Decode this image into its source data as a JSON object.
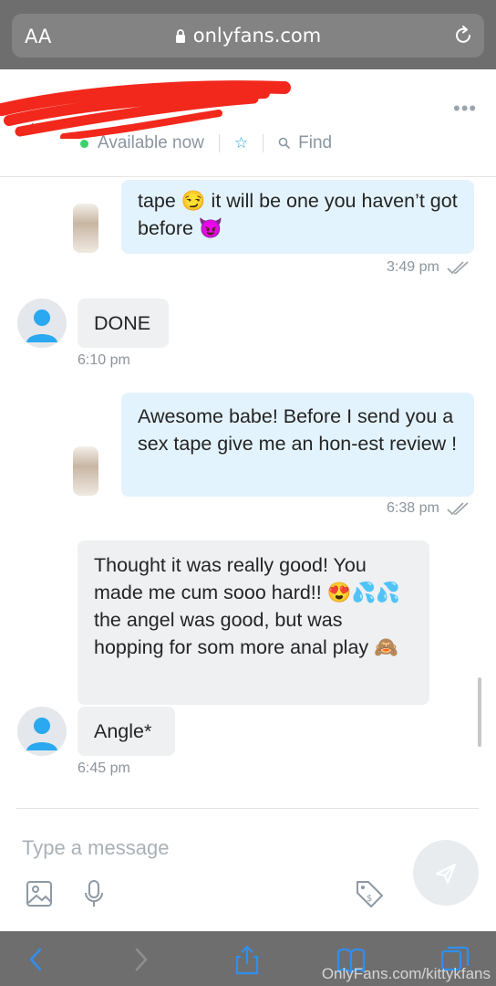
{
  "browser": {
    "text_size_button": "AA",
    "url": "onlyfans.com"
  },
  "header": {
    "status": "Available now",
    "find_label": "Find"
  },
  "messages": [
    {
      "text": "tape 😏 it will be one you haven’t got before 😈",
      "time": "3:49 pm"
    },
    {
      "text": "DONE",
      "time": "6:10 pm"
    },
    {
      "text": "Awesome babe! Before I send you a sex tape give me an hon-est review !",
      "time": "6:38 pm"
    },
    {
      "text": "Thought it was really good! You made me cum sooo hard!! 😍💦💦 the angel was good, but was hopping for som more anal play 🙈"
    },
    {
      "text": "Angle*",
      "time": "6:45 pm"
    }
  ],
  "composer": {
    "placeholder": "Type a message"
  },
  "watermark": "OnlyFans.com/kittykfans",
  "colors": {
    "outgoing_bubble": "#e3f3fd",
    "incoming_bubble": "#eef0f2",
    "accent": "#1ea8e8",
    "online": "#3ad26a",
    "redaction": "#f2281c"
  }
}
